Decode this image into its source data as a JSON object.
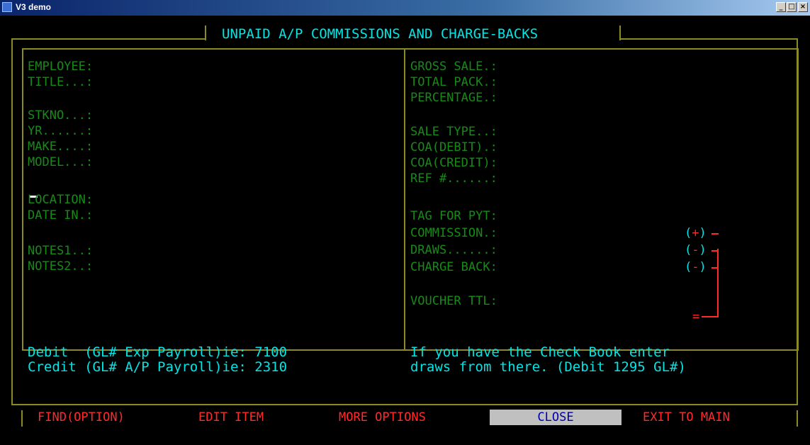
{
  "window": {
    "title": "V3 demo",
    "min_glyph": "_",
    "max_glyph": "□",
    "close_glyph": "×"
  },
  "screen_title": "UNPAID A/P COMMISSIONS AND CHARGE-BACKS",
  "left_fields": [
    {
      "label": "EMPLOYEE:"
    },
    {
      "label": "TITLE...:"
    },
    {
      "label": "STKNO...:"
    },
    {
      "label": "YR......:"
    },
    {
      "label": "MAKE....:"
    },
    {
      "label": "MODEL...:"
    },
    {
      "label": "LOCATION:"
    },
    {
      "label": "DATE IN.:"
    },
    {
      "label": "NOTES1..:"
    },
    {
      "label": "NOTES2..:"
    }
  ],
  "right_fields": [
    {
      "label": "GROSS SALE.:"
    },
    {
      "label": "TOTAL PACK.:"
    },
    {
      "label": "PERCENTAGE.:"
    },
    {
      "label": "SALE TYPE..:"
    },
    {
      "label": "COA(DEBIT).:"
    },
    {
      "label": "COA(CREDIT):"
    },
    {
      "label": "REF #......:"
    },
    {
      "label": "TAG FOR PYT:"
    },
    {
      "label": "COMMISSION.:"
    },
    {
      "label": "DRAWS......:"
    },
    {
      "label": "CHARGE BACK:"
    },
    {
      "label": "VOUCHER TTL:"
    }
  ],
  "signs": [
    "+",
    "-",
    "-"
  ],
  "total_sign": "=",
  "gl_info": {
    "debit": "Debit  (GL# Exp Payroll)ie: 7100",
    "credit": "Credit (GL# A/P Payroll)ie: 2310",
    "note_line1": "If you have the Check Book enter",
    "note_line2": "draws from there. (Debit 1295 GL#)"
  },
  "menu": {
    "find": "FIND(OPTION)",
    "edit": "EDIT ITEM",
    "more": "MORE OPTIONS",
    "close": "CLOSE",
    "exit": "EXIT TO MAIN"
  },
  "colors": {
    "border": "#8b8a25",
    "label_green": "#178a17",
    "cyan": "#00e5e5",
    "red": "#ff2a2a",
    "highlight": "#c0c0c0"
  }
}
